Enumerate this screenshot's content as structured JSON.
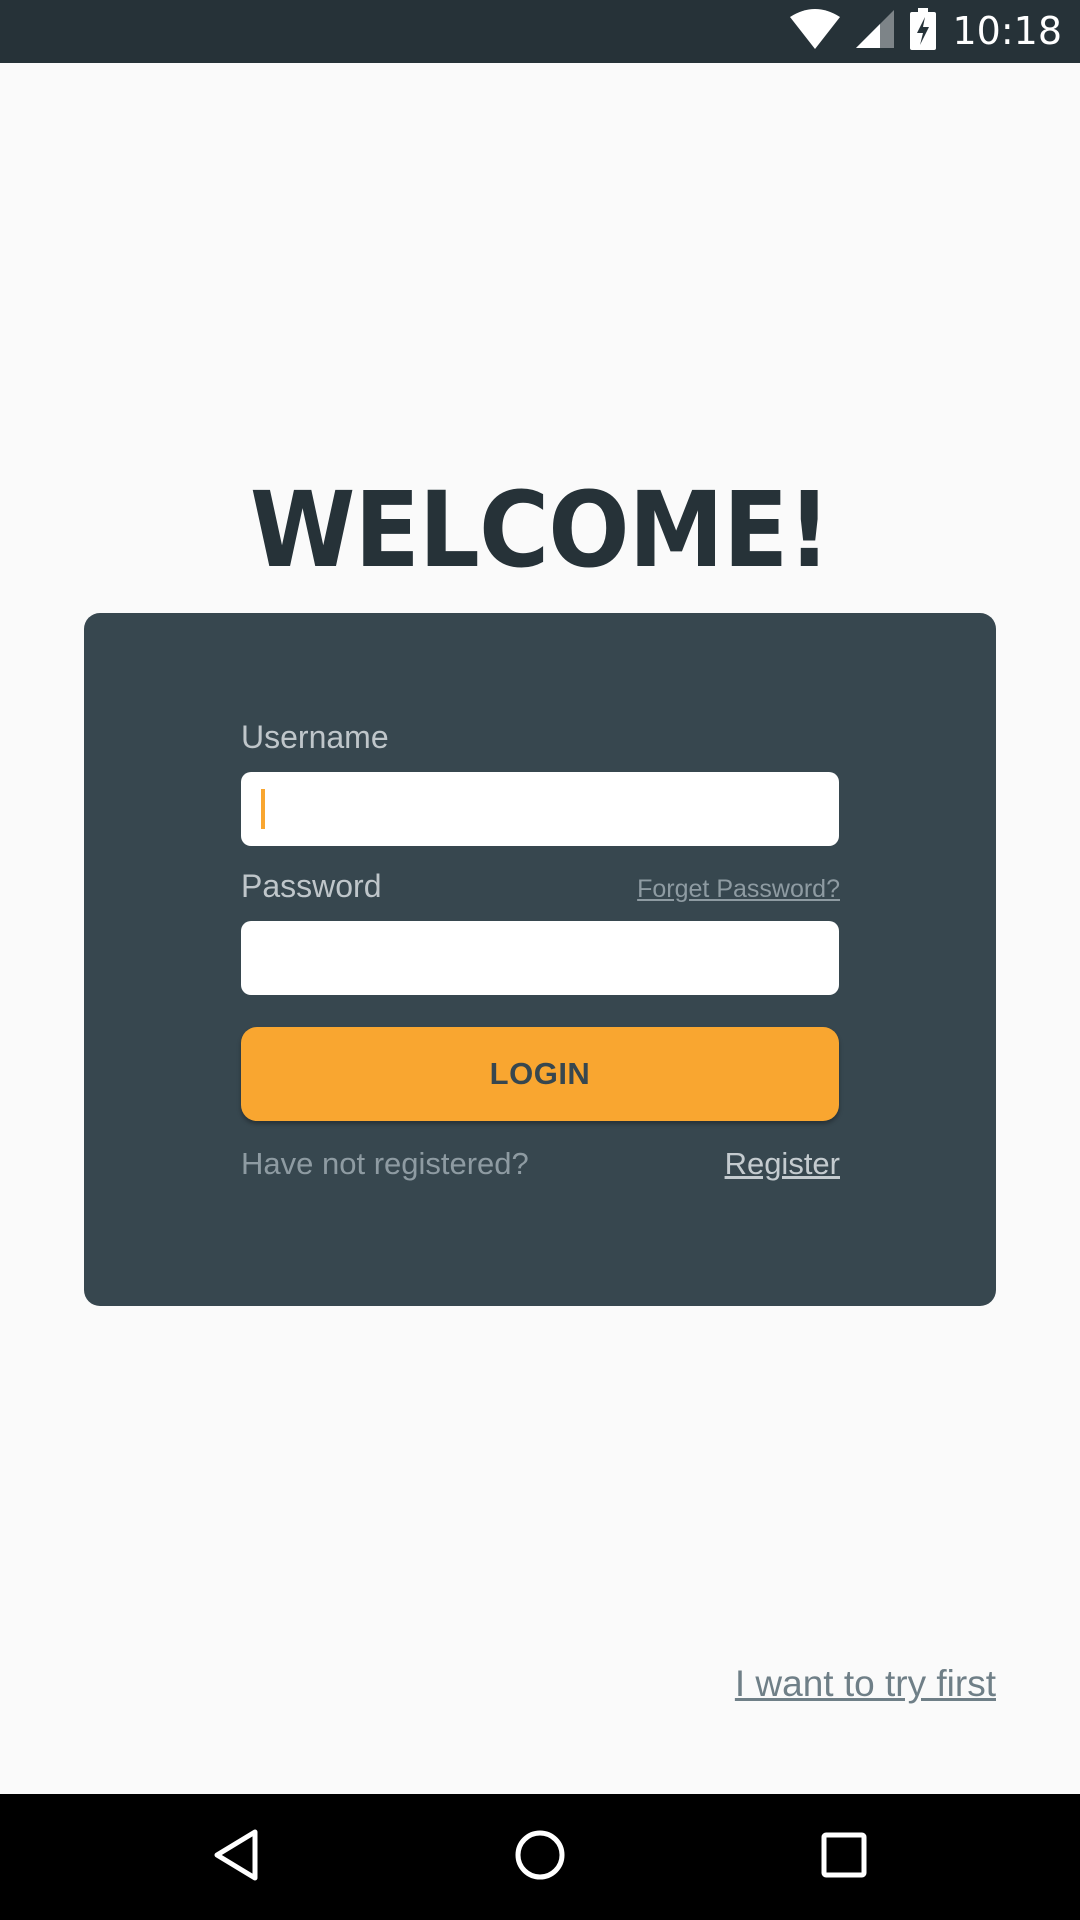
{
  "status_bar": {
    "time": "10:18",
    "icons": [
      "wifi-icon",
      "cell-signal-icon",
      "battery-charging-icon"
    ]
  },
  "welcome": {
    "title": "WELCOME!"
  },
  "login_card": {
    "username_label": "Username",
    "username_value": "",
    "password_label": "Password",
    "password_value": "",
    "forget_password_label": "Forget Password?",
    "login_button_label": "LOGIN",
    "not_registered_text": "Have not registered?",
    "register_label": "Register"
  },
  "try_first_label": "I want to try first",
  "nav_bar": {
    "icons": [
      "back-icon",
      "home-icon",
      "recents-icon"
    ]
  },
  "colors": {
    "status_bar": "#263238",
    "background": "#fafafa",
    "card": "#37474f",
    "accent": "#f9a630",
    "title": "#263238"
  }
}
